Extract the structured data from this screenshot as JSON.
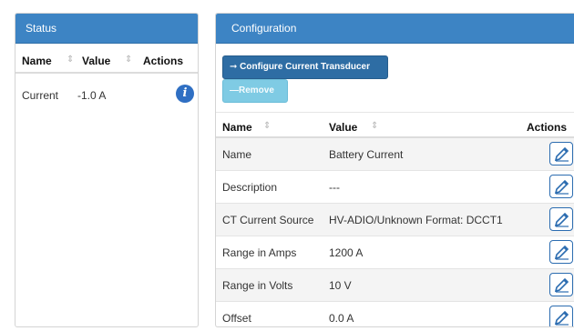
{
  "status": {
    "title": "Status",
    "columns": {
      "name": "Name",
      "value": "Value",
      "actions": "Actions"
    },
    "rows": [
      {
        "name": "Current",
        "value": "-1.0 A",
        "action_icon": "info-icon"
      }
    ]
  },
  "config": {
    "title": "Configuration",
    "buttons": {
      "configure": "Configure Current Transducer",
      "remove": "Remove"
    },
    "columns": {
      "name": "Name",
      "value": "Value",
      "actions": "Actions"
    },
    "rows": [
      {
        "name": "Name",
        "value": "Battery Current"
      },
      {
        "name": "Description",
        "value": "---"
      },
      {
        "name": "CT Current Source",
        "value": "HV-ADIO/Unknown Format: DCCT1"
      },
      {
        "name": "Range in Amps",
        "value": "1200 A"
      },
      {
        "name": "Range in Volts",
        "value": "10 V"
      },
      {
        "name": "Offset",
        "value": "0.0 A"
      }
    ],
    "action_icon": "edit-icon"
  },
  "colors": {
    "panel_header": "#3d84c4",
    "primary_button": "#2e6da4",
    "info_button": "#7fcbe4",
    "edit_border": "#2b6cb0"
  }
}
